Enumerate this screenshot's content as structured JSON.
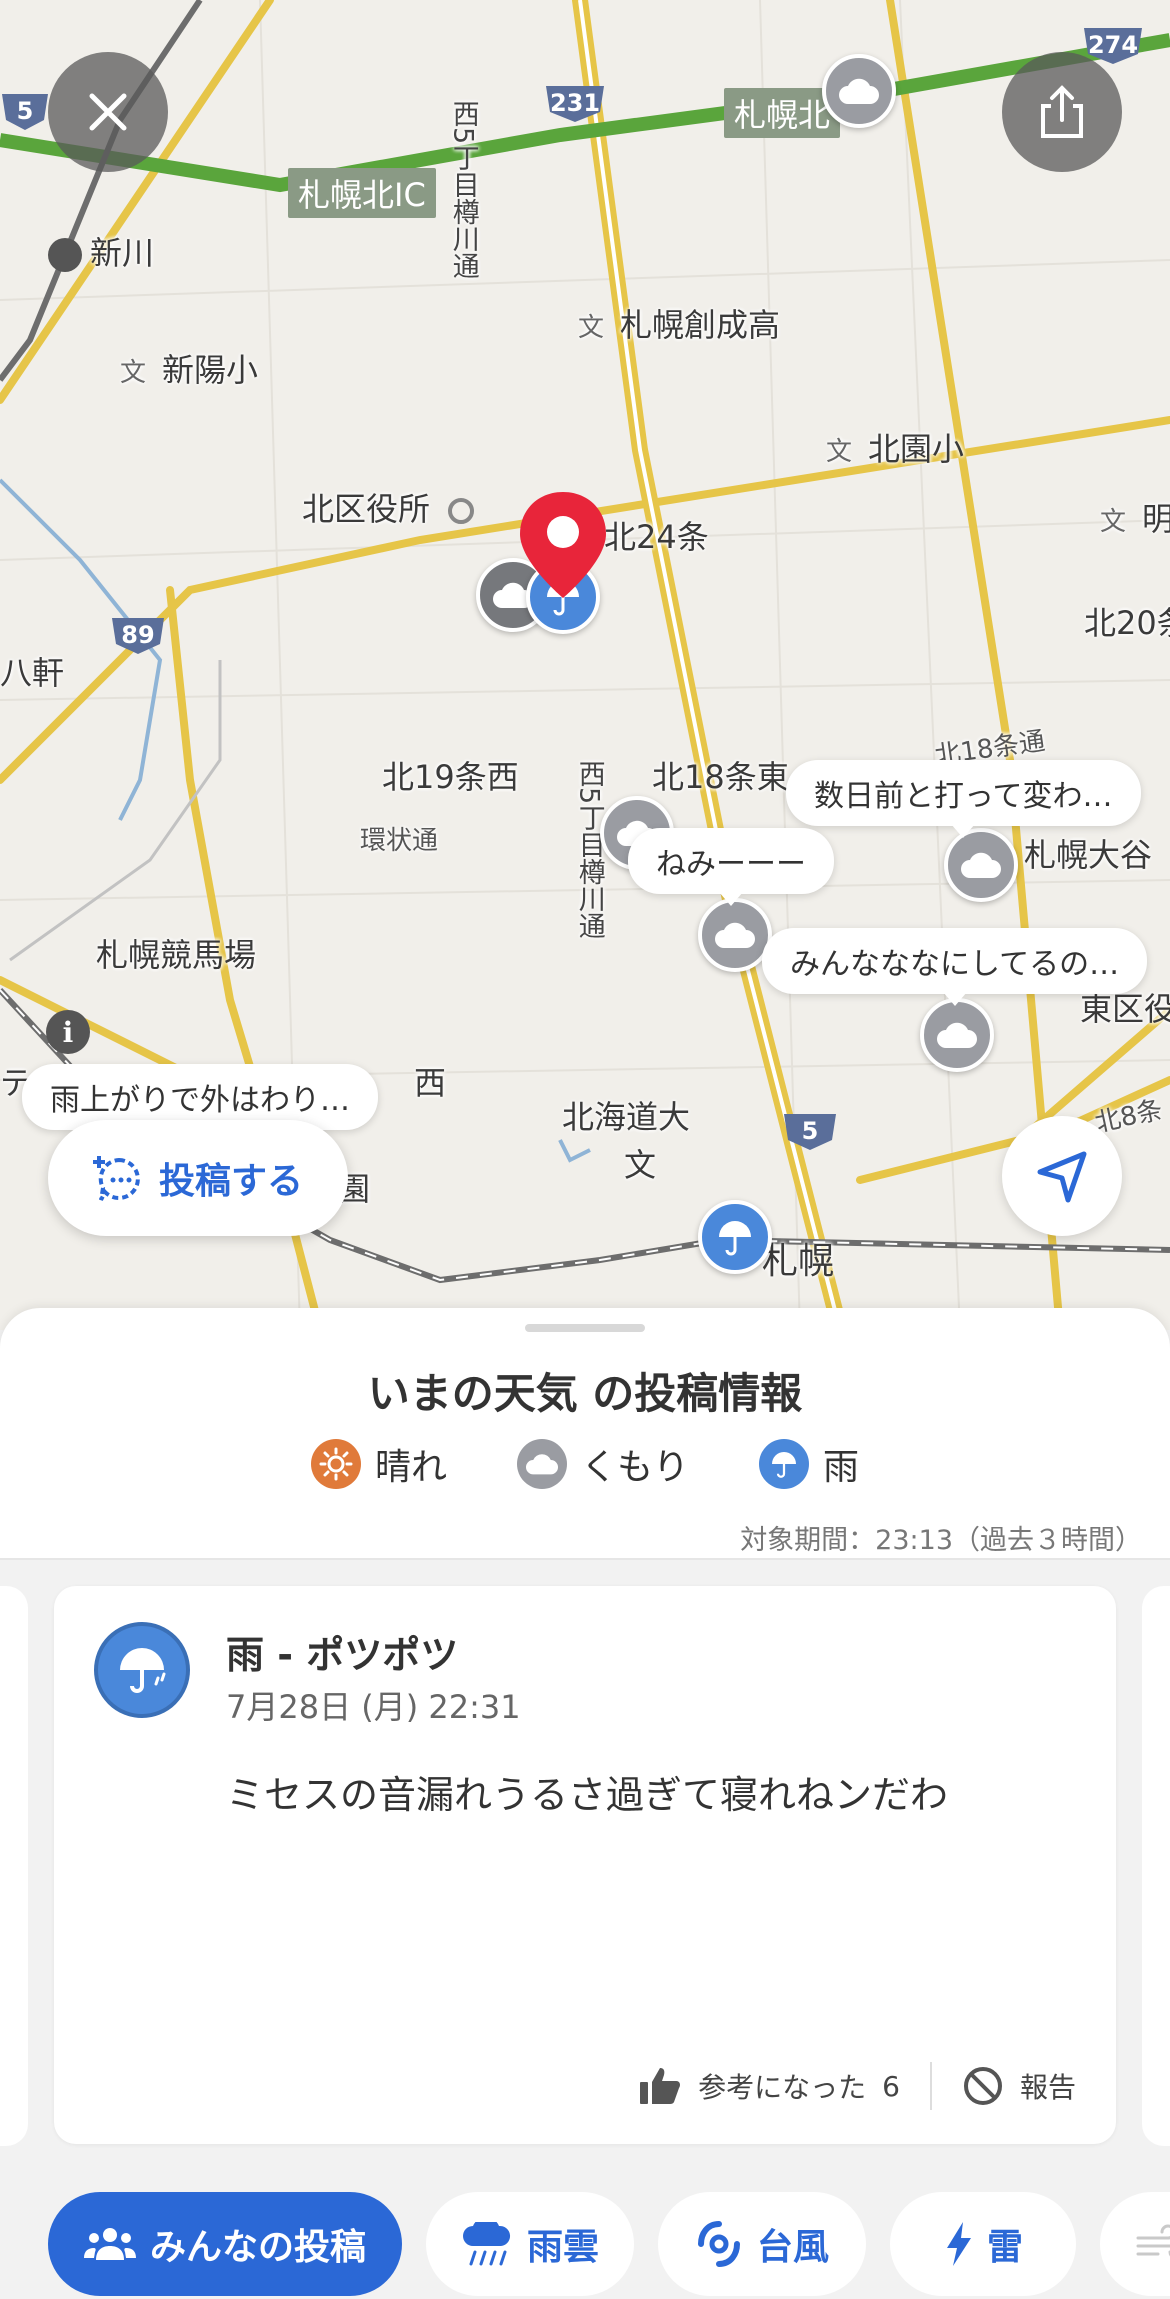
{
  "map": {
    "labels": {
      "shinkawa": "新川",
      "shinyo_sho": "新陽小",
      "sousei_ko": "札幌創成高",
      "kitazono_sho": "北園小",
      "kitaku_yakusho": "北区役所",
      "kita24jo": "北24条",
      "kita20": "北20条",
      "hachiken": "八軒",
      "kita19jo_nishi": "北19条西",
      "kita18jo_higashi": "北18条東",
      "kanjo_dori": "環状通",
      "keibajo": "札幌競馬場",
      "hokkaido_dai": "北海道大",
      "sapporo": "札幌",
      "kita18jo_dori": "北18条通",
      "kita8jo": "北8条",
      "higashi_ku": "東区役",
      "sapporo_ootani": "札幌大谷",
      "mei": "明",
      "nishi_partial": "西",
      "nishi5_chome_1": "西5丁目樽川通",
      "nishi5_chome_2": "西5丁目樽川通",
      "en": "園",
      "te": "テ",
      "bun_mark": "文"
    },
    "ic_tags": {
      "kita_ic": "札幌北IC",
      "kita_ic_2": "札幌北"
    },
    "route_shields": {
      "r5_left": "5",
      "r231": "231",
      "r274": "274",
      "r89": "89",
      "r5_bottom": "5"
    },
    "bubbles": {
      "b1": "数日前と打って変わ…",
      "b2": "ねみーーー",
      "b3": "みんなななにしてるの…",
      "b4": "雨上がりで外はわり…"
    },
    "info_glyph": "i",
    "post_button_label": "投稿する"
  },
  "sheet": {
    "title": "いまの天気 の投稿情報",
    "legend": [
      {
        "label": "晴れ",
        "color": "#e07a3a"
      },
      {
        "label": "くもり",
        "color": "#9a9ca2"
      },
      {
        "label": "雨",
        "color": "#4a88da"
      }
    ],
    "period": "対象期間：23:13（過去３時間）"
  },
  "card": {
    "title": "雨 - ポツポツ",
    "date": "7月28日 (月) 22:31",
    "body": "ミセスの音漏れうるさ過ぎて寝れねンだわ",
    "helpful_label": "参考になった",
    "helpful_count": "6",
    "report_label": "報告"
  },
  "bottom_nav": {
    "items": [
      {
        "label": "みんなの投稿",
        "active": true
      },
      {
        "label": "雨雲",
        "active": false
      },
      {
        "label": "台風",
        "active": false
      },
      {
        "label": "雷",
        "active": false
      }
    ]
  },
  "colors": {
    "accent": "#2b68d6",
    "rain": "#4a88da",
    "cloud": "#9a9ca2",
    "sun": "#e07a3a",
    "pin": "#e8253a",
    "highway": "#5aa53c",
    "road": "#e6c548"
  }
}
